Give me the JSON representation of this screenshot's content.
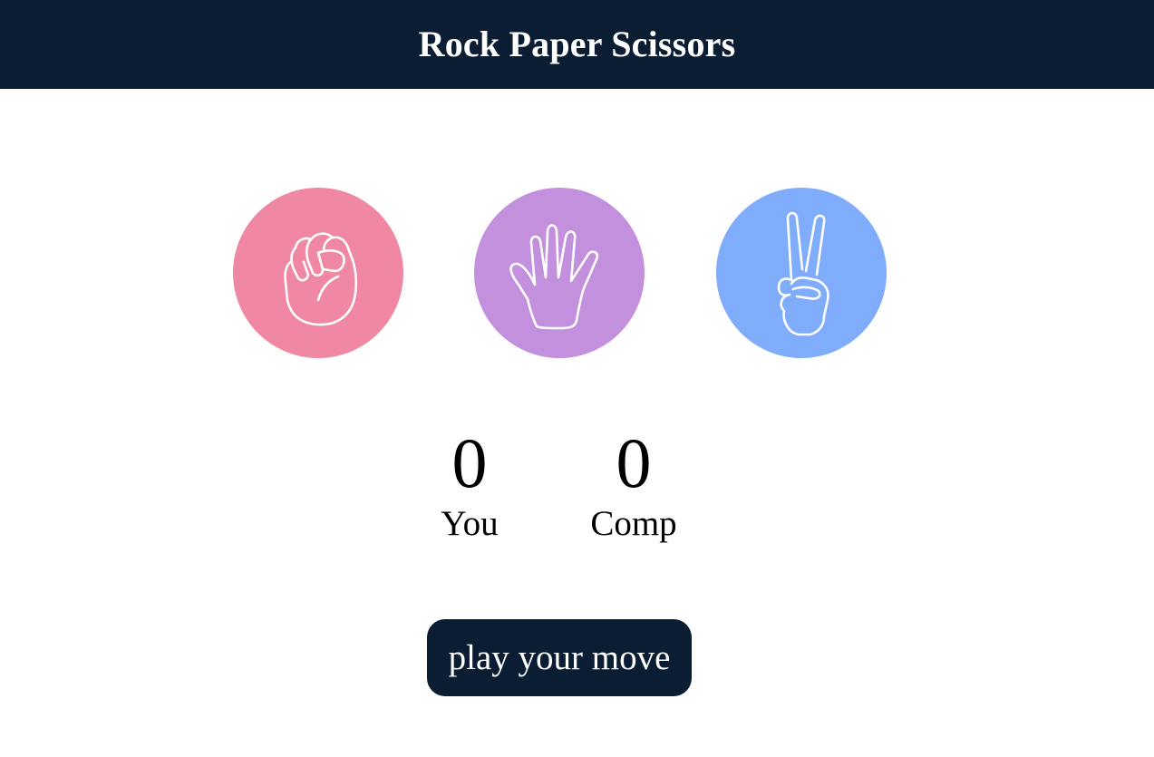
{
  "header": {
    "title": "Rock Paper Scissors"
  },
  "choices": [
    {
      "id": "rock",
      "icon": "fist-icon",
      "color": "#f088a3"
    },
    {
      "id": "paper",
      "icon": "open-hand-icon",
      "color": "#c290dc"
    },
    {
      "id": "scissors",
      "icon": "peace-hand-icon",
      "color": "#80acfc"
    }
  ],
  "scoreboard": {
    "you": {
      "score": "0",
      "label": "You"
    },
    "comp": {
      "score": "0",
      "label": "Comp"
    }
  },
  "play_button": {
    "label": "play your move",
    "color": "#0a1d33"
  }
}
